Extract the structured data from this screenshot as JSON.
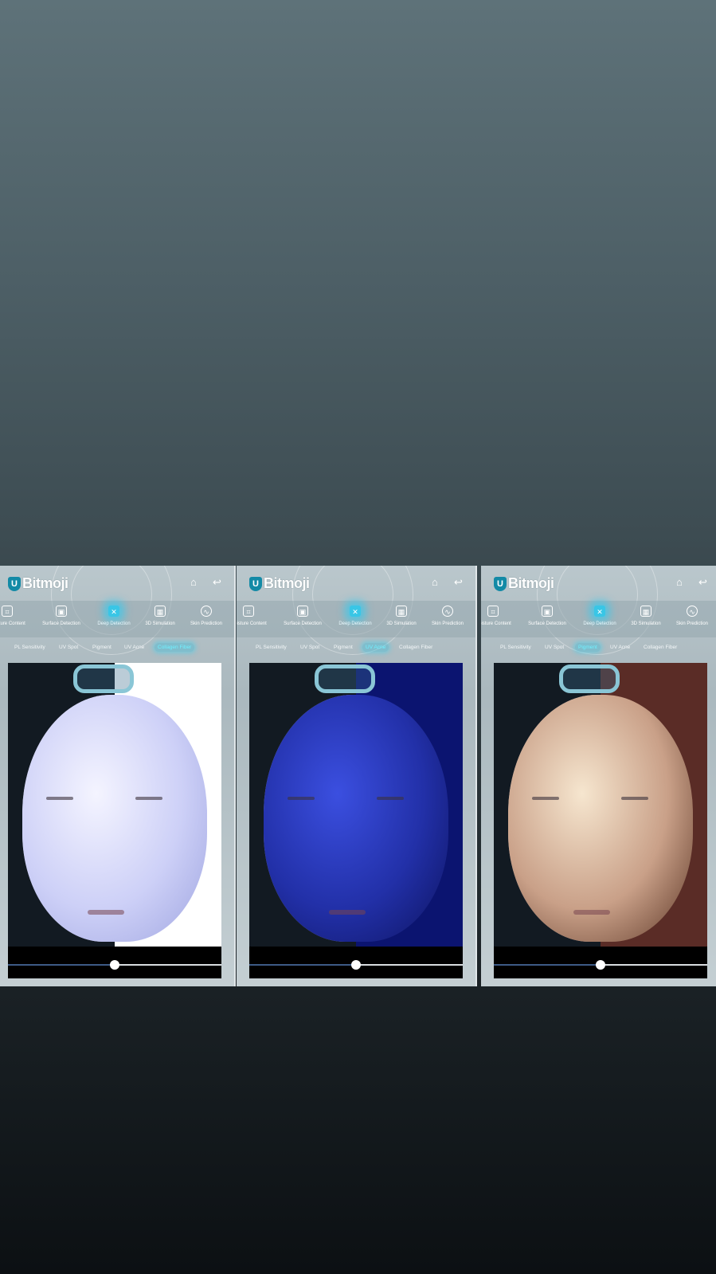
{
  "panels": [
    {
      "brand": "Bitmoji",
      "nav": [
        "Moisture Content",
        "Surface Detection",
        "Deep Detection",
        "3D Simulation",
        "Skin Prediction"
      ],
      "active_nav": "Deep Detection",
      "tabs": [
        "PL Sensitivity",
        "UV Spot",
        "Pigment",
        "UV Acne",
        "Collagen Fiber"
      ],
      "active_tab": "Collagen Fiber",
      "comparison_split": 0.5
    },
    {
      "brand": "Bitmoji",
      "nav": [
        "Moisture Content",
        "Surface Detection",
        "Deep Detection",
        "3D Simulation",
        "Skin Prediction"
      ],
      "active_nav": "Deep Detection",
      "tabs": [
        "PL Sensitivity",
        "UV Spot",
        "Pigment",
        "UV Acne",
        "Collagen Fiber"
      ],
      "active_tab": "UV Acne",
      "comparison_split": 0.5
    },
    {
      "brand": "Bitmoji",
      "nav": [
        "Moisture Content",
        "Surface Detection",
        "Deep Detection",
        "3D Simulation",
        "Skin Prediction"
      ],
      "active_nav": "Deep Detection",
      "tabs": [
        "PL Sensitivity",
        "UV Spot",
        "Pigment",
        "UV Acne",
        "Collagen Fiber"
      ],
      "active_tab": "Pigment",
      "comparison_split": 0.5
    }
  ],
  "icons": {
    "home": "home-icon",
    "back": "back-icon",
    "nav": [
      "thermometer-icon",
      "image-icon",
      "molecule-icon",
      "3d-icon",
      "heartbeat-icon"
    ]
  },
  "colors": {
    "accent": "#39c6e6",
    "brand_badge": "#138aa6",
    "collagen_filter": "#cdd0f7",
    "uv_acne_filter": "#2230a8",
    "pigment_filter": "#c9a088"
  }
}
